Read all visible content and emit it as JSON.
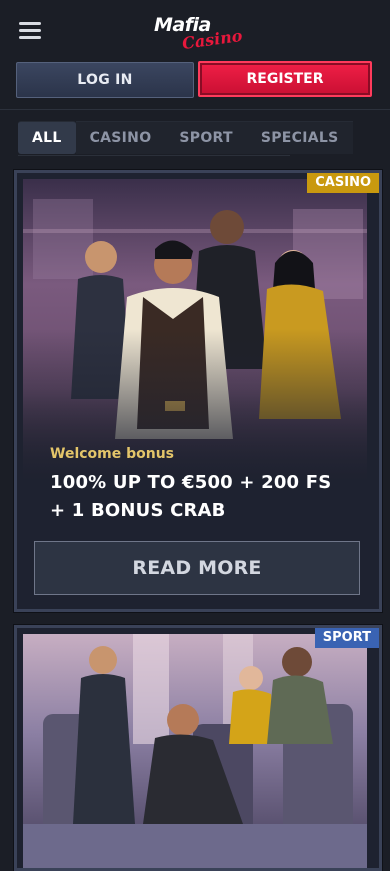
{
  "header": {
    "menu_icon": "hamburger-menu-icon",
    "logo": {
      "main": "Mafia",
      "sub": "Casino"
    }
  },
  "auth": {
    "login_label": "LOG IN",
    "register_label": "REGISTER"
  },
  "tabs": [
    {
      "label": "ALL",
      "active": true
    },
    {
      "label": "CASINO",
      "active": false
    },
    {
      "label": "SPORT",
      "active": false
    },
    {
      "label": "SPECIALS",
      "active": false
    }
  ],
  "promos": [
    {
      "badge": "CASINO",
      "eyebrow": "Welcome bonus",
      "title": "100% UP TO €500 + 200 FS + 1 BONUS CRAB",
      "cta": "READ MORE",
      "image": "mafia-characters-illustration"
    },
    {
      "badge": "SPORT",
      "image": "mafia-characters-stadium-illustration"
    }
  ],
  "colors": {
    "background": "#1b1e26",
    "register": "#e8183c",
    "casino_badge": "#c9990f",
    "sport_badge": "#3a63b3",
    "welcome_text": "#e3c56a"
  }
}
